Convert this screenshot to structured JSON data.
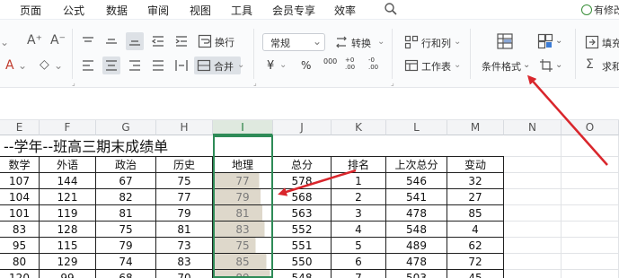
{
  "menu": {
    "items": [
      "页面",
      "公式",
      "数据",
      "审阅",
      "视图",
      "工具",
      "会员专享",
      "效率"
    ],
    "right_label": "有修改"
  },
  "ribbon": {
    "number_format": "常规",
    "convert_label": "转换",
    "row_col_label": "行和列",
    "wrap_label": "换行",
    "merge_label": "合并",
    "worksheet_label": "工作表",
    "cond_format_label": "条件格式",
    "fill_label": "填充",
    "sum_label": "求和",
    "currency_symbol": "¥",
    "percent_symbol": "%",
    "thousands_symbol": "000",
    "dec_inc_symbol": "+0 .00",
    "dec_dec_symbol": "-0 .00"
  },
  "columns": [
    "E",
    "F",
    "G",
    "H",
    "I",
    "J",
    "K",
    "L",
    "M",
    "N",
    "O"
  ],
  "active_column": "I",
  "sheet": {
    "title": "--学年--班高三期末成绩单",
    "headers": [
      "数学",
      "外语",
      "政治",
      "历史",
      "地理",
      "总分",
      "排名",
      "上次总分",
      "变动"
    ],
    "rows": [
      [
        "107",
        "144",
        "67",
        "75",
        "77",
        "578",
        "1",
        "546",
        "32"
      ],
      [
        "104",
        "121",
        "82",
        "77",
        "79",
        "568",
        "2",
        "541",
        "27"
      ],
      [
        "101",
        "119",
        "81",
        "79",
        "81",
        "563",
        "3",
        "478",
        "85"
      ],
      [
        "83",
        "128",
        "75",
        "81",
        "83",
        "552",
        "4",
        "548",
        "4"
      ],
      [
        "95",
        "115",
        "79",
        "73",
        "75",
        "551",
        "5",
        "489",
        "62"
      ],
      [
        "80",
        "129",
        "74",
        "83",
        "85",
        "550",
        "6",
        "478",
        "72"
      ],
      [
        "120",
        "99",
        "68",
        "70",
        "89",
        "548",
        "7",
        "503",
        "45"
      ]
    ],
    "geo_fill_fraction": [
      0.78,
      0.8,
      0.83,
      0.87,
      0.72,
      0.9,
      0.96
    ]
  },
  "colors": {
    "selection_border": "#2e8b57",
    "data_bar": "#ded8cb",
    "annotation_arrow": "#d9262c"
  }
}
